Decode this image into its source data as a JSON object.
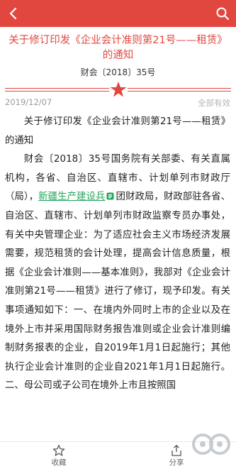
{
  "header": {
    "back_icon": "chevron-left-icon",
    "search_icon": "search-icon",
    "accent_color": "#e2473f"
  },
  "document": {
    "title": "关于修订印发《企业会计准则第21号——租赁》的通知",
    "number": "财会〔2018〕35号",
    "date": "2019/12/07",
    "status": "全部有效"
  },
  "body": {
    "p1": "关于修订印发《企业会计准则第21号——租赁》的通知",
    "p2_before": "财会〔2018〕35号国务院有关部委、有关直属机构，各省、自治区、直辖市、计划单列市财政厅（局），",
    "p2_link": "新疆生产建设兵",
    "p2_after": "团财政局，财政部驻各省、自治区、直辖市、计划单列市财政监察专员办事处，有关中央管理企业：为了适应社会主义市场经济发展需要，规范租赁的会计处理，提高会计信息质量，根据《企业会计准则——基本准则》，我部对《企业会计准则第21号——租赁》进行了修订，现予印发。有关事项通知如下：一、在境内外同时上市的企业以及在境外上市并采用国际财务报告准则或企业会计准则编制财务报表的企业，自2019年1月1日起施行；其他执行企业会计准则的企业自2021年1月1日起施行。二、母公司或子公司在境外上市且按照国"
  },
  "footer": {
    "favorite_label": "收藏",
    "share_label": "分享"
  }
}
